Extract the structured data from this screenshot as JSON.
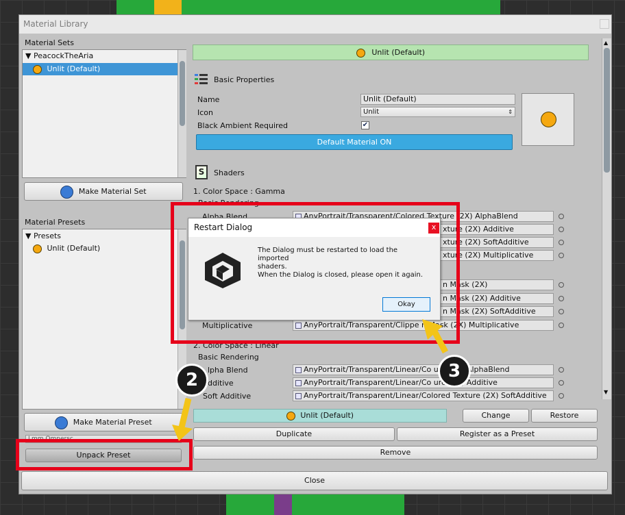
{
  "window": {
    "title": "Material Library"
  },
  "material_sets": {
    "header": "Material Sets",
    "tree_root": "PeacockTheAria",
    "tree_item": "Unlit (Default)",
    "make_button": "Make Material Set"
  },
  "material_presets": {
    "header": "Material Presets",
    "tree_root": "Presets",
    "tree_item": "Unlit (Default)",
    "make_button": "Make Material Preset",
    "dropdown_value": "Lmm Omnersc",
    "unpack_button": "Unpack Preset"
  },
  "selected_material": {
    "label": "Unlit (Default)"
  },
  "basic_properties": {
    "header": "Basic Properties",
    "name_label": "Name",
    "name_value": "Unlit (Default)",
    "icon_label": "Icon",
    "icon_value": "Unlit",
    "ambient_label": "Black Ambient Required",
    "ambient_checked": true,
    "default_button": "Default Material ON"
  },
  "shaders": {
    "header": "Shaders",
    "section1": "1. Color Space : Gamma",
    "section1_sub": "Basic Rendering",
    "rows1": [
      {
        "label": "Alpha Blend",
        "value": "AnyPortrait/Transparent/Colored Texture (2X) AlphaBlend"
      },
      {
        "label": "",
        "value": "xture (2X) Additive"
      },
      {
        "label": "",
        "value": "xture (2X) SoftAdditive"
      },
      {
        "label": "",
        "value": "xture (2X) Multiplicative"
      }
    ],
    "rows_clipped": [
      {
        "label": "",
        "value": "n Mask (2X)"
      },
      {
        "label": "",
        "value": "n Mask (2X) Additive"
      },
      {
        "label": "",
        "value": "n Mask (2X) SoftAdditive"
      },
      {
        "label": "Multiplicative",
        "value": "AnyPortrait/Transparent/Clippe  n Mask (2X) Multiplicative"
      }
    ],
    "section2": "2. Color Space : Linear",
    "section2_sub": "Basic Rendering",
    "rows2": [
      {
        "label": "lpha Blend",
        "value": "AnyPortrait/Transparent/Linear/Co      ure (2X) AlphaBlend"
      },
      {
        "label": "dditive",
        "value": "AnyPortrait/Transparent/Linear/Co      ure (2X) Additive"
      },
      {
        "label": "Soft Additive",
        "value": "AnyPortrait/Transparent/Linear/Colored Texture (2X) SoftAdditive"
      }
    ]
  },
  "footer": {
    "current": "Unlit (Default)",
    "change": "Change",
    "restore": "Restore",
    "duplicate": "Duplicate",
    "register": "Register as a Preset",
    "remove": "Remove",
    "close": "Close"
  },
  "dialog": {
    "title": "Restart Dialog",
    "close_glyph": "x",
    "message_line1": "The Dialog must be restarted to load the imported",
    "message_line2": "shaders.",
    "message_line3": "When the Dialog is closed, please open it again.",
    "ok_button": "Okay"
  },
  "callouts": {
    "step2": "2",
    "step3": "3"
  },
  "colors": {
    "highlight_red": "#e6001a",
    "arrow_yellow": "#f3c418",
    "selected_blue": "#3e95d6",
    "default_button_blue": "#3aa9e0",
    "header_green": "#b6e4b0",
    "footer_teal": "#a9ddd8"
  }
}
